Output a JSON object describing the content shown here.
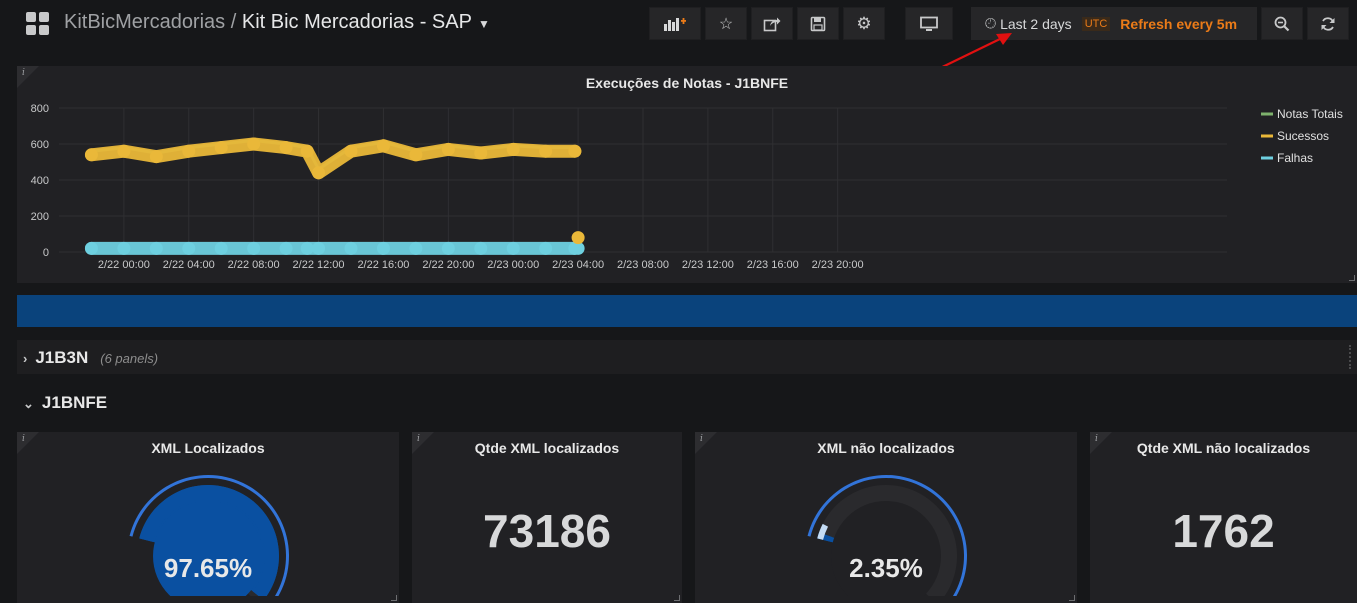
{
  "navbar": {
    "folder": "KitBicMercadorias",
    "separator": "/",
    "dashboard_title": "Kit Bic Mercadorias - SAP",
    "buttons": [
      "add-panel",
      "star",
      "share",
      "save",
      "settings",
      "tv-mode",
      "zoom-out",
      "refresh"
    ],
    "time_range": "Last 2 days",
    "timezone": "UTC",
    "refresh_label": "Refresh every 5m"
  },
  "graph_panel": {
    "title": "Execuções de Notas - J1BNFE",
    "chart_data": {
      "type": "line",
      "title": "Execuções de Notas - J1BNFE",
      "y_ticks": [
        "800",
        "600",
        "400",
        "200",
        "0"
      ],
      "ylim": [
        0,
        800
      ],
      "x_ticks": [
        "2/22 00:00",
        "2/22 04:00",
        "2/22 08:00",
        "2/22 12:00",
        "2/22 16:00",
        "2/22 20:00",
        "2/23 00:00",
        "2/23 04:00",
        "2/23 08:00",
        "2/23 12:00",
        "2/23 16:00",
        "2/23 20:00"
      ],
      "grid": true,
      "legend_position": "right",
      "series": [
        {
          "name": "Notas Totais",
          "color": "#7eb26d"
        },
        {
          "name": "Sucessos",
          "color": "#eab839"
        },
        {
          "name": "Falhas",
          "color": "#6ed0e0"
        }
      ],
      "x_hours": [
        -2,
        0,
        2,
        4,
        6,
        8,
        10,
        11.3,
        12,
        14,
        16,
        18,
        20,
        22,
        24,
        26,
        27.8,
        28
      ],
      "sucessos_values": [
        540,
        560,
        530,
        560,
        580,
        600,
        580,
        560,
        440,
        560,
        590,
        540,
        570,
        550,
        570,
        560,
        560,
        80
      ],
      "falhas_values": [
        20,
        20,
        20,
        20,
        20,
        20,
        20,
        20,
        20,
        20,
        20,
        20,
        20,
        20,
        20,
        20,
        20,
        20
      ],
      "notas_totais_values": [
        560,
        580,
        550,
        580,
        600,
        620,
        600,
        580,
        460,
        580,
        610,
        560,
        590,
        570,
        590,
        580,
        580,
        100
      ]
    }
  },
  "rows": [
    {
      "title": "J1B3N",
      "count": "(6 panels)",
      "collapsed": true
    },
    {
      "title": "J1BNFE",
      "collapsed": false
    }
  ],
  "stat_panels": [
    {
      "title": "XML Localizados",
      "kind": "gauge",
      "value": "97.65%",
      "fraction": 0.9765
    },
    {
      "title": "Qtde XML localizados",
      "kind": "number",
      "value": "73186"
    },
    {
      "title": "XML não localizados",
      "kind": "gauge",
      "value": "2.35%",
      "fraction": 0.0235
    },
    {
      "title": "Qtde XML não localizados",
      "kind": "number",
      "value": "1762"
    }
  ],
  "colors": {
    "gauge_blue": "#0a50a1",
    "gauge_threshold_blue": "#3274d9",
    "gauge_light": "#c4dcf5",
    "accent_orange": "#eb7b18",
    "banner_blue": "#0a437c"
  }
}
